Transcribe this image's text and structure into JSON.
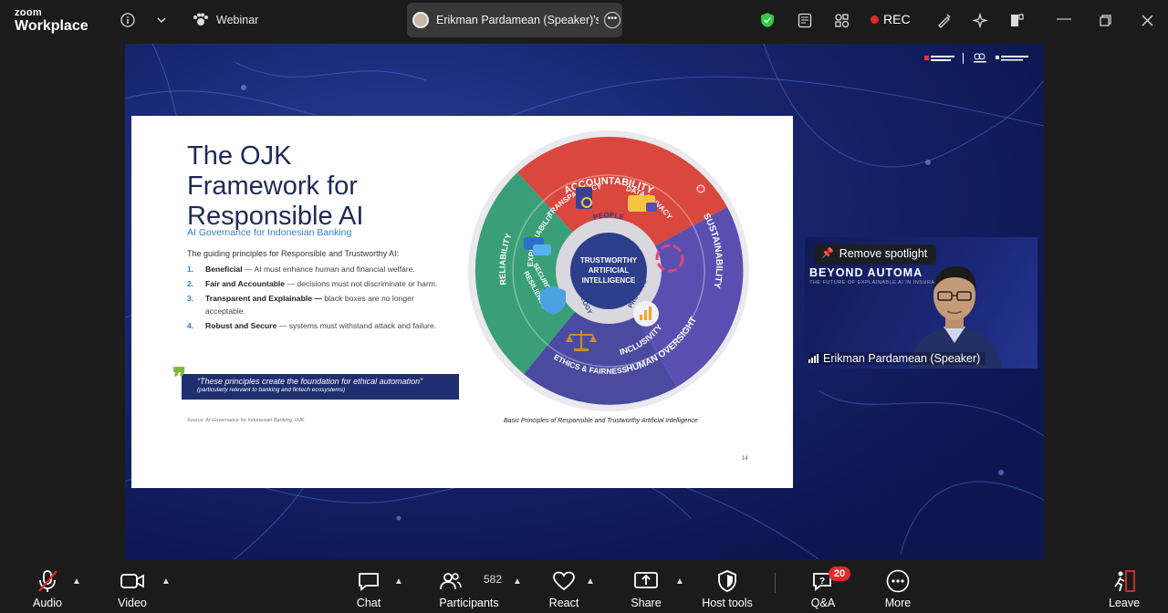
{
  "app": {
    "brand_small": "zoom",
    "brand_big": "Workplace",
    "meeting_type": "Webinar"
  },
  "topbar": {
    "speaker_view_label": "Erikman Pardamean (Speaker)'s sc",
    "rec_label": "REC",
    "colors": {
      "shield": "#2ecc40",
      "rec_dot": "#e02828"
    }
  },
  "slide": {
    "title": "The OJK Framework for Responsible AI",
    "subtitle": "AI Governance for Indonesian Banking",
    "intro": "The guiding principles for Responsible and Trustworthy AI:",
    "principles": [
      {
        "num": "1.",
        "name": "Beneficial",
        "desc": " — AI must enhance human and financial welfare."
      },
      {
        "num": "2.",
        "name": "Fair and Accountable",
        "desc": " — decisions must not discriminate or harm."
      },
      {
        "num": "3.",
        "name": "Transparent and Explainable —",
        "desc": " black boxes are no longer acceptable."
      },
      {
        "num": "4.",
        "name": "Robust and Secure",
        "desc": " — systems must withstand attack and failure."
      }
    ],
    "quote": "“These principles create the foundation for ethical automation”",
    "quote_note": "(particularly relevant to banking and fintech ecosystems)",
    "source": "Source: AI Governance for Indonesian Banking, OJK",
    "caption": "Basic Principles of Responsible and Trustworthy Artificial Intelligence",
    "page_number": "14",
    "wheel": {
      "center": [
        "TRUSTWORTHY",
        "ARTIFICIAL",
        "INTELLIGENCE"
      ],
      "inner": {
        "top": "PEOPLE",
        "left": "TECHNOLOGY",
        "right": "PROCESS"
      },
      "segments": {
        "accountability": "ACCOUNTABILITY",
        "transparency": "TRANSPARENCY",
        "data_privacy": "DATA PRIVACY",
        "sustainability": "SUSTAINABILITY",
        "human_oversight": "HUMAN OVERSIGHT",
        "inclusivity": "INCLUSIVITY",
        "ethics": "ETHICS & FAIRNESS",
        "reliability": "RELIABILITY",
        "explainability": "EXPLAINABILITY",
        "security": "SECURITY AND",
        "resilience": "RESILIENCE"
      },
      "colors": {
        "red": "#d9473f",
        "purple": "#5a4fb0",
        "green": "#3a9f78",
        "center": "#2c3e8c"
      }
    }
  },
  "video": {
    "spotlight_label": "Remove spotlight",
    "bg_title": "BEYOND AUTOMA",
    "bg_sub": "THE FUTURE OF EXPLAINABLE AI IN INSURANCE",
    "name": "Erikman Pardamean (Speaker)"
  },
  "bottombar": {
    "audio": "Audio",
    "video": "Video",
    "chat": "Chat",
    "participants": "Participants",
    "participants_count": "582",
    "react": "React",
    "share": "Share",
    "host_tools": "Host tools",
    "qa": "Q&A",
    "qa_badge": "20",
    "more": "More",
    "leave": "Leave"
  }
}
